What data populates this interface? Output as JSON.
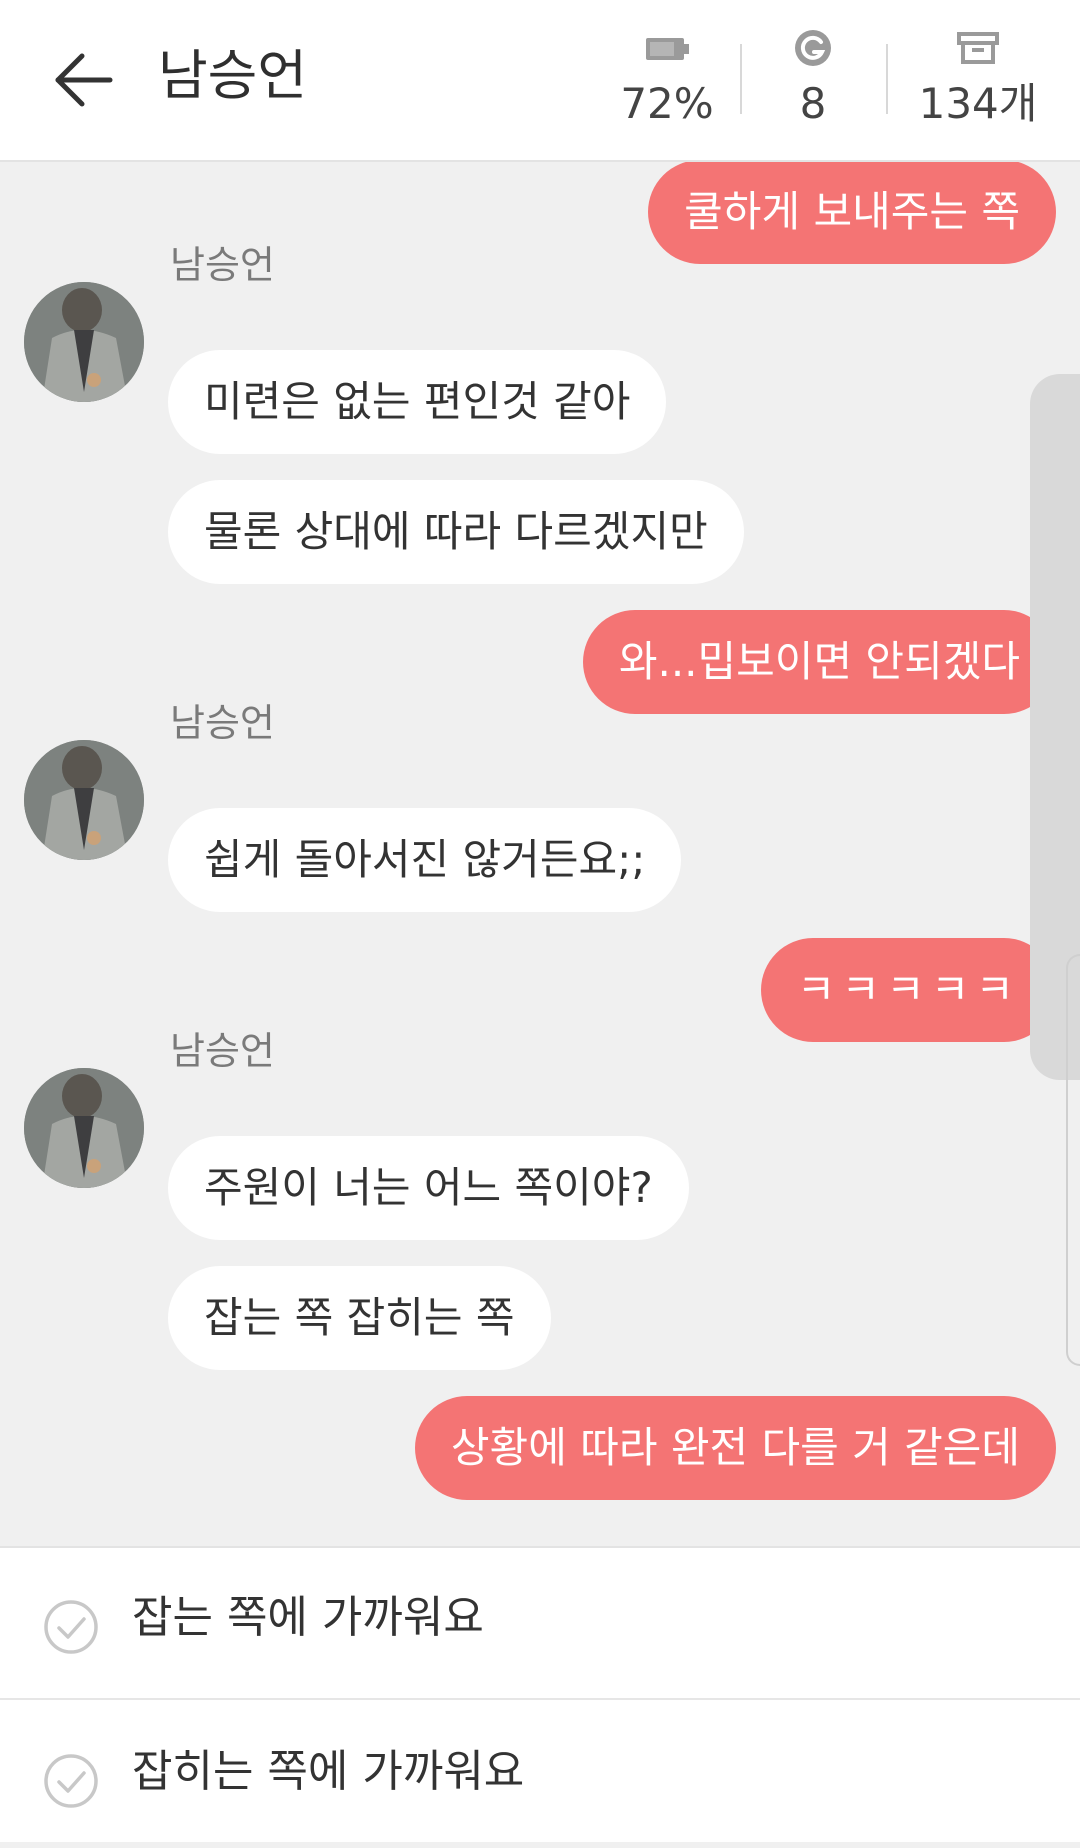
{
  "header": {
    "title": "남승언",
    "battery": "72%",
    "gauge": "8",
    "archive": "134개",
    "back_icon": "arrow-left-icon",
    "battery_icon": "battery-icon",
    "gauge_icon": "g-coin-icon",
    "archive_icon": "archive-box-icon"
  },
  "chat": {
    "sender": "남승언",
    "messages": [
      {
        "side": "out",
        "text": "쿨하게 보내주는 쪽"
      },
      {
        "side": "in",
        "text": "미련은 없는 편인것 같아"
      },
      {
        "side": "in",
        "text": "물론 상대에 따라 다르겠지만"
      },
      {
        "side": "out",
        "text": "와...밉보이면 안되겠다"
      },
      {
        "side": "in",
        "text": "쉽게 돌아서진 않거든요;;"
      },
      {
        "side": "out",
        "text": "ㅋㅋㅋㅋㅋ"
      },
      {
        "side": "in",
        "text": "주원이 너는 어느 쪽이야?"
      },
      {
        "side": "in",
        "text": "잡는 쪽 잡히는 쪽"
      },
      {
        "side": "out",
        "text": "상황에 따라 완전 다를 거 같은데"
      }
    ]
  },
  "choices": [
    {
      "label": "잡는 쪽에 가까워요",
      "icon": "check-circle-icon"
    },
    {
      "label": "잡히는 쪽에 가까워요",
      "icon": "check-circle-icon"
    }
  ],
  "colors": {
    "outgoing_bubble": "#f47474",
    "incoming_bubble": "#ffffff",
    "background": "#f0f0f0"
  }
}
